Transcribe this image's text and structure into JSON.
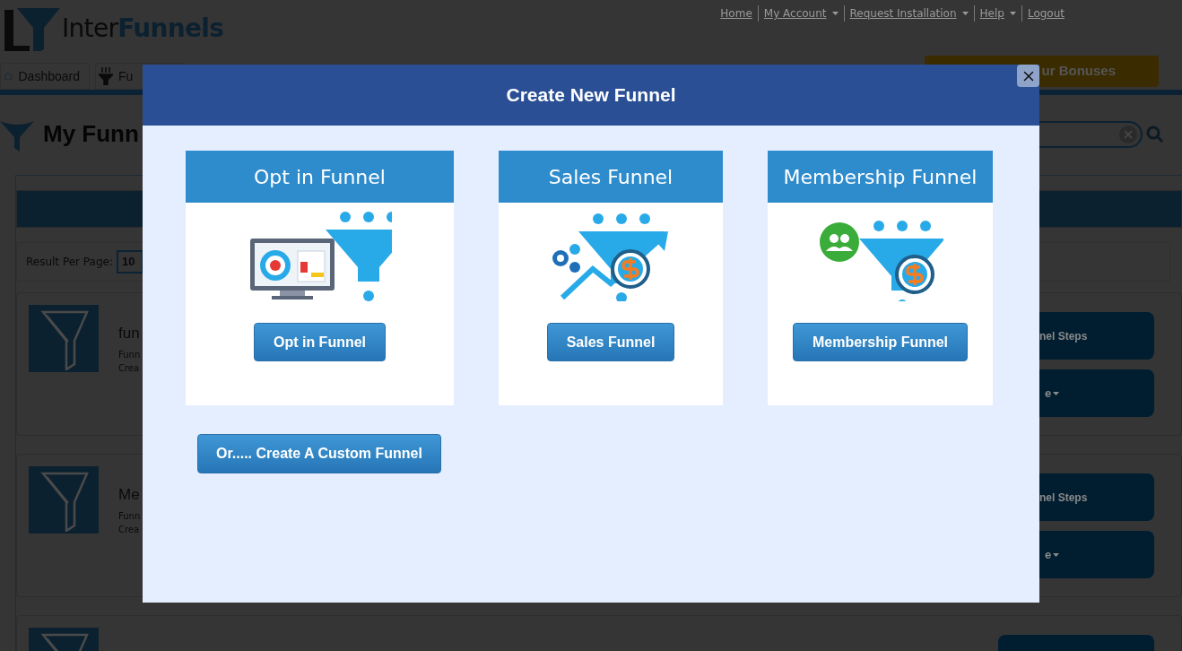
{
  "header": {
    "logo": {
      "part_1": "Inter",
      "part_2": "Funnels"
    },
    "links": [
      {
        "label": "Home",
        "dropdown": false
      },
      {
        "label": "My Account",
        "dropdown": true
      },
      {
        "label": "Request Installation",
        "dropdown": true
      },
      {
        "label": "Help",
        "dropdown": true
      },
      {
        "label": "Logout",
        "dropdown": false
      }
    ]
  },
  "nav": {
    "tabs": [
      {
        "label": "Dashboard",
        "kind": "home"
      },
      {
        "label": "Fu",
        "kind": "funnel"
      }
    ],
    "bonus_button": "ur Bonuses"
  },
  "page_title": "My Funn",
  "results_per_page": {
    "label": "Result Per Page:",
    "value": "10"
  },
  "funnels": [
    {
      "name": "fun",
      "line_1": "Funn",
      "line_2": "Crea",
      "steps_button": "nel Steps",
      "more_button": "e"
    },
    {
      "name": "Me",
      "line_1": "Funn",
      "line_2": "Crea",
      "steps_button": "nel Steps",
      "more_button": "e"
    }
  ],
  "modal": {
    "title": "Create New Funnel",
    "options": [
      {
        "title": "Opt in Funnel",
        "kind": "optin",
        "button": "Opt in Funnel"
      },
      {
        "title": "Sales Funnel",
        "kind": "sales",
        "button": "Sales Funnel"
      },
      {
        "title": "Membership Funnel",
        "kind": "membership",
        "button": "Membership Funnel"
      }
    ],
    "custom_button": "Or..... Create A Custom Funnel"
  }
}
